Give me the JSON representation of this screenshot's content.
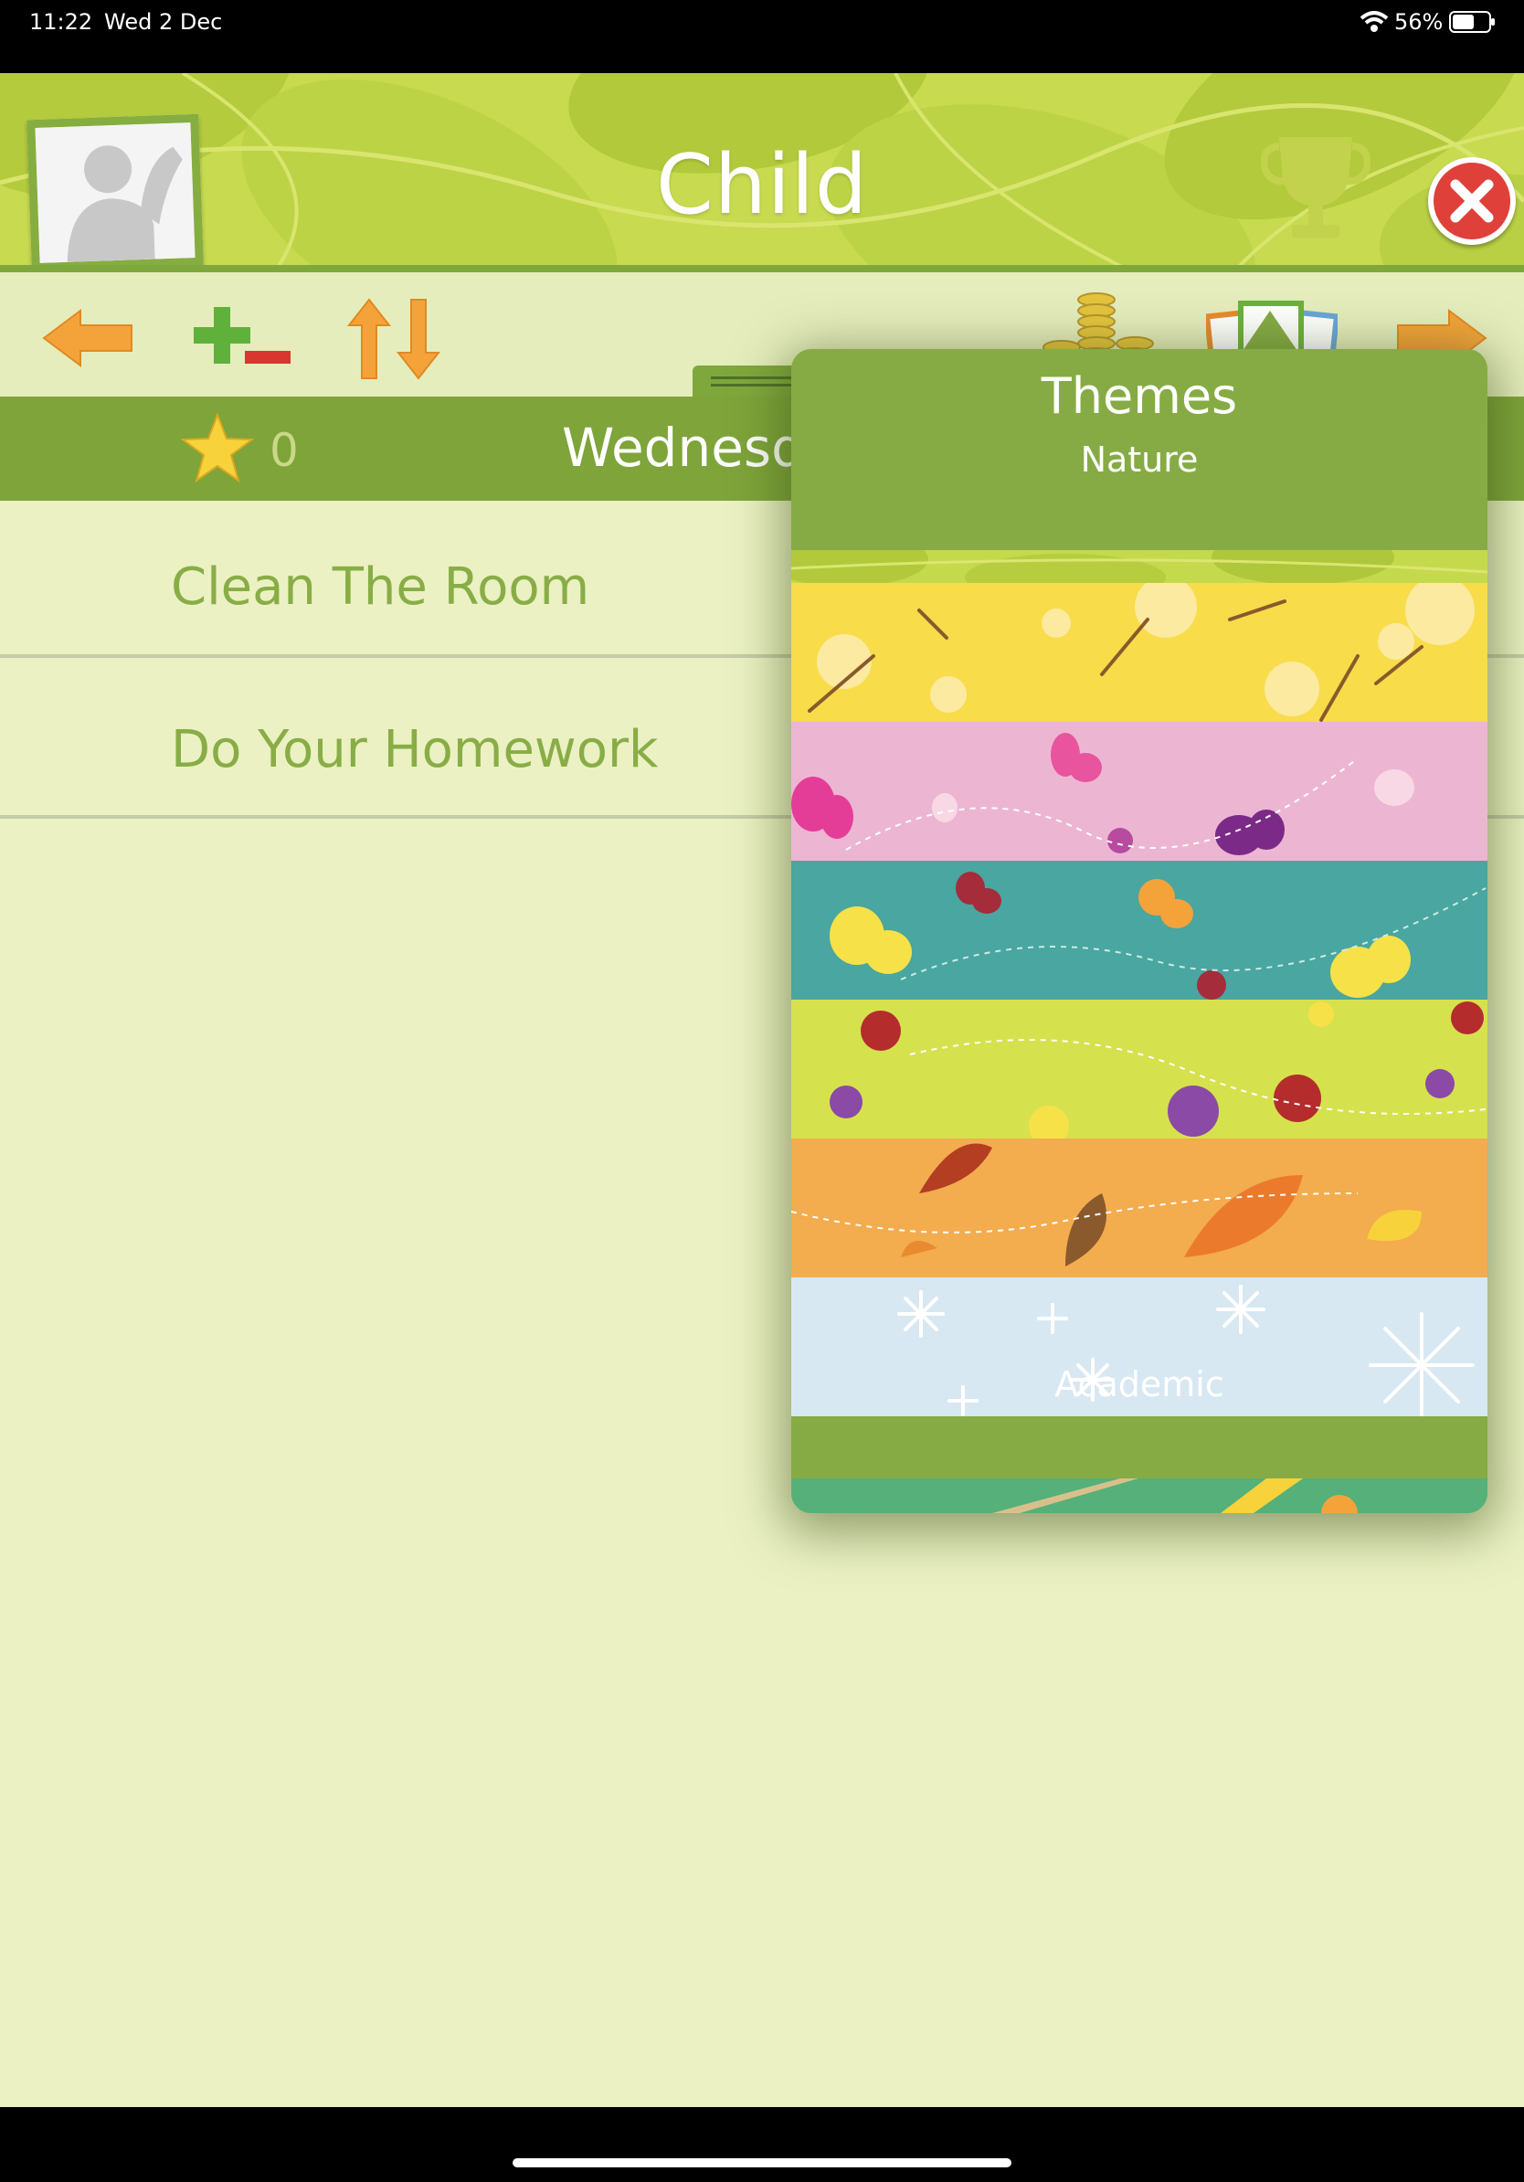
{
  "status_bar": {
    "time": "11:22",
    "date": "Wed 2 Dec",
    "battery": "56%"
  },
  "header": {
    "title": "Child"
  },
  "day_bar": {
    "stars": "0",
    "day": "Wednesday"
  },
  "tasks": [
    {
      "label": "Clean The Room"
    },
    {
      "label": "Do Your Homework"
    }
  ],
  "themes_popover": {
    "title": "Themes",
    "sections": [
      {
        "title": "Nature",
        "themes": [
          "leaves-green",
          "dandelion-yellow",
          "butterflies-pink",
          "butterflies-teal",
          "flowers-lime",
          "autumn-orange",
          "snowflakes-blue"
        ]
      },
      {
        "title": "Academic",
        "themes": [
          "ruler-green"
        ]
      }
    ]
  },
  "colors": {
    "header_green": "#c8da4f",
    "band_green": "#7ea43a",
    "background": "#ebf1c3",
    "task_text": "#89ad46",
    "accent_orange": "#f3a33a",
    "close_red": "#e0403a"
  }
}
